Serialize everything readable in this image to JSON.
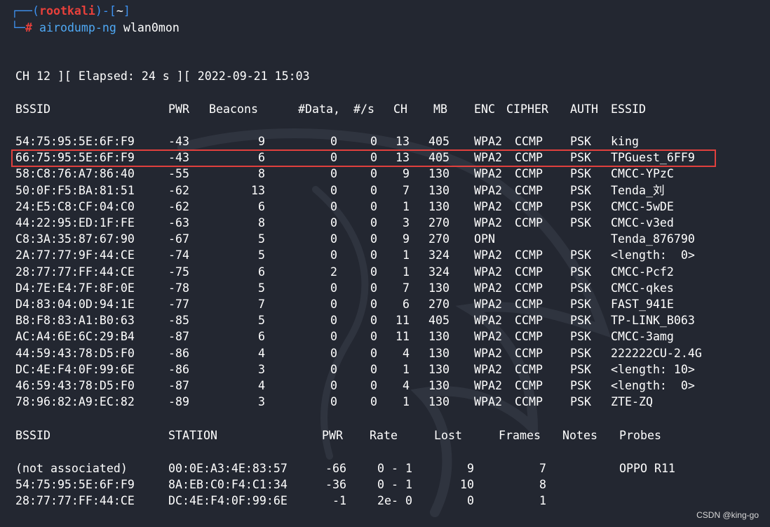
{
  "prompt": {
    "user": "rootkali",
    "cwd": "~",
    "hash": "#",
    "command": "airodump-ng",
    "arg": "wlan0mon"
  },
  "status_line": "CH 12 ][ Elapsed: 24 s ][ 2022-09-21 15:03",
  "ap_headers": [
    "BSSID",
    "PWR",
    "Beacons",
    "#Data,",
    "#/s",
    "CH",
    "MB",
    "ENC",
    "CIPHER",
    "AUTH",
    "ESSID"
  ],
  "access_points": [
    {
      "bssid": "54:75:95:5E:6F:F9",
      "pwr": "-43",
      "beacons": "9",
      "data": "0",
      "s": "0",
      "ch": "13",
      "mb": "405",
      "enc": "WPA2",
      "cipher": "CCMP",
      "auth": "PSK",
      "essid": "king"
    },
    {
      "bssid": "66:75:95:5E:6F:F9",
      "pwr": "-43",
      "beacons": "6",
      "data": "0",
      "s": "0",
      "ch": "13",
      "mb": "405",
      "enc": "WPA2",
      "cipher": "CCMP",
      "auth": "PSK",
      "essid": "TPGuest_6FF9"
    },
    {
      "bssid": "58:C8:76:A7:86:40",
      "pwr": "-55",
      "beacons": "8",
      "data": "0",
      "s": "0",
      "ch": "9",
      "mb": "130",
      "enc": "WPA2",
      "cipher": "CCMP",
      "auth": "PSK",
      "essid": "CMCC-YPzC"
    },
    {
      "bssid": "50:0F:F5:BA:81:51",
      "pwr": "-62",
      "beacons": "13",
      "data": "0",
      "s": "0",
      "ch": "7",
      "mb": "130",
      "enc": "WPA2",
      "cipher": "CCMP",
      "auth": "PSK",
      "essid": "Tenda_刘"
    },
    {
      "bssid": "24:E5:C8:CF:04:C0",
      "pwr": "-62",
      "beacons": "6",
      "data": "0",
      "s": "0",
      "ch": "1",
      "mb": "130",
      "enc": "WPA2",
      "cipher": "CCMP",
      "auth": "PSK",
      "essid": "CMCC-5wDE"
    },
    {
      "bssid": "44:22:95:ED:1F:FE",
      "pwr": "-63",
      "beacons": "8",
      "data": "0",
      "s": "0",
      "ch": "3",
      "mb": "270",
      "enc": "WPA2",
      "cipher": "CCMP",
      "auth": "PSK",
      "essid": "CMCC-v3ed"
    },
    {
      "bssid": "C8:3A:35:87:67:90",
      "pwr": "-67",
      "beacons": "5",
      "data": "0",
      "s": "0",
      "ch": "9",
      "mb": "270",
      "enc": "OPN",
      "cipher": "",
      "auth": "",
      "essid": "Tenda_876790"
    },
    {
      "bssid": "2A:77:77:9F:44:CE",
      "pwr": "-74",
      "beacons": "5",
      "data": "0",
      "s": "0",
      "ch": "1",
      "mb": "324",
      "enc": "WPA2",
      "cipher": "CCMP",
      "auth": "PSK",
      "essid": "<length:  0>"
    },
    {
      "bssid": "28:77:77:FF:44:CE",
      "pwr": "-75",
      "beacons": "6",
      "data": "2",
      "s": "0",
      "ch": "1",
      "mb": "324",
      "enc": "WPA2",
      "cipher": "CCMP",
      "auth": "PSK",
      "essid": "CMCC-Pcf2"
    },
    {
      "bssid": "D4:7E:E4:7F:8F:0E",
      "pwr": "-78",
      "beacons": "5",
      "data": "0",
      "s": "0",
      "ch": "7",
      "mb": "130",
      "enc": "WPA2",
      "cipher": "CCMP",
      "auth": "PSK",
      "essid": "CMCC-qkes"
    },
    {
      "bssid": "D4:83:04:0D:94:1E",
      "pwr": "-77",
      "beacons": "7",
      "data": "0",
      "s": "0",
      "ch": "6",
      "mb": "270",
      "enc": "WPA2",
      "cipher": "CCMP",
      "auth": "PSK",
      "essid": "FAST_941E"
    },
    {
      "bssid": "B8:F8:83:A1:B0:63",
      "pwr": "-85",
      "beacons": "5",
      "data": "0",
      "s": "0",
      "ch": "11",
      "mb": "405",
      "enc": "WPA2",
      "cipher": "CCMP",
      "auth": "PSK",
      "essid": "TP-LINK_B063"
    },
    {
      "bssid": "AC:A4:6E:6C:29:B4",
      "pwr": "-87",
      "beacons": "6",
      "data": "0",
      "s": "0",
      "ch": "11",
      "mb": "130",
      "enc": "WPA2",
      "cipher": "CCMP",
      "auth": "PSK",
      "essid": "CMCC-3amg"
    },
    {
      "bssid": "44:59:43:78:D5:F0",
      "pwr": "-86",
      "beacons": "4",
      "data": "0",
      "s": "0",
      "ch": "4",
      "mb": "130",
      "enc": "WPA2",
      "cipher": "CCMP",
      "auth": "PSK",
      "essid": "222222CU-2.4G"
    },
    {
      "bssid": "DC:4E:F4:0F:99:6E",
      "pwr": "-86",
      "beacons": "3",
      "data": "0",
      "s": "0",
      "ch": "1",
      "mb": "130",
      "enc": "WPA2",
      "cipher": "CCMP",
      "auth": "PSK",
      "essid": "<length: 10>"
    },
    {
      "bssid": "46:59:43:78:D5:F0",
      "pwr": "-87",
      "beacons": "4",
      "data": "0",
      "s": "0",
      "ch": "4",
      "mb": "130",
      "enc": "WPA2",
      "cipher": "CCMP",
      "auth": "PSK",
      "essid": "<length:  0>"
    },
    {
      "bssid": "78:96:82:A9:EC:82",
      "pwr": "-89",
      "beacons": "3",
      "data": "0",
      "s": "0",
      "ch": "1",
      "mb": "130",
      "enc": "WPA2",
      "cipher": "CCMP",
      "auth": "PSK",
      "essid": "ZTE-ZQ"
    }
  ],
  "station_headers": [
    "BSSID",
    "STATION",
    "PWR",
    "Rate",
    "Lost",
    "Frames",
    "Notes",
    "Probes"
  ],
  "stations": [
    {
      "bssid": "(not associated)",
      "station": "00:0E:A3:4E:83:57",
      "pwr": "-66",
      "rate": "0 - 1",
      "lost": "9",
      "frames": "7",
      "notes": "",
      "probes": "OPPO R11"
    },
    {
      "bssid": "54:75:95:5E:6F:F9",
      "station": "8A:EB:C0:F4:C1:34",
      "pwr": "-36",
      "rate": "0 - 1",
      "lost": "10",
      "frames": "8",
      "notes": "",
      "probes": ""
    },
    {
      "bssid": "28:77:77:FF:44:CE",
      "station": "DC:4E:F4:0F:99:6E",
      "pwr": "-1",
      "rate": "2e- 0",
      "lost": "0",
      "frames": "1",
      "notes": "",
      "probes": ""
    }
  ],
  "watermark": "CSDN @king-go",
  "colors": {
    "background": "#232731",
    "prompt_blue": "#3e92f0",
    "user_red": "#e8403b",
    "highlight_border": "#e0403d"
  }
}
